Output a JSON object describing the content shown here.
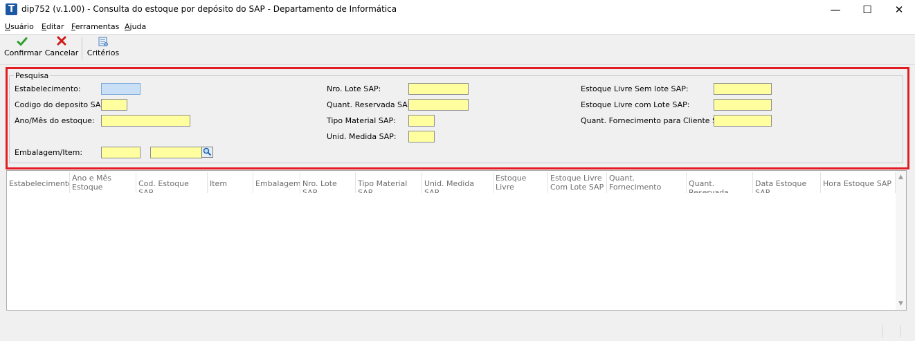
{
  "window": {
    "title": "dip752 (v.1.00) - Consulta do estoque por depósito do SAP - Departamento de Informática",
    "app_icon_letter": "T",
    "minimize_glyph": "—",
    "maximize_glyph": "☐",
    "close_glyph": "✕"
  },
  "menu": [
    {
      "label": "Usuário",
      "accel": "U",
      "rest": "suário"
    },
    {
      "label": "Editar",
      "accel": "E",
      "rest": "ditar"
    },
    {
      "label": "Ferramentas",
      "accel": "F",
      "rest": "erramentas"
    },
    {
      "label": "Ajuda",
      "accel": "A",
      "rest": "juda"
    }
  ],
  "toolbar": {
    "confirm_label": "Confirmar",
    "cancel_label": "Cancelar",
    "criteria_label": "Critérios",
    "confirm_icon": "checkmark-icon",
    "cancel_icon": "x-icon",
    "criteria_icon": "criteria-icon"
  },
  "search": {
    "legend": "Pesquisa",
    "labels": {
      "estabelecimento": "Estabelecimento:",
      "codigo_deposito": "Codigo do deposito SAP:",
      "ano_mes": "Ano/Mês do estoque:",
      "embalagem_item": "Embalagem/Item:",
      "nro_lote": "Nro. Lote SAP:",
      "quant_reservada": "Quant. Reservada SAP:",
      "tipo_material": "Tipo Material SAP:",
      "unid_medida": "Unid. Medida SAP:",
      "estoque_sem_lote": "Estoque Livre Sem lote SAP:",
      "estoque_com_lote": "Estoque Livre com Lote SAP:",
      "quant_fornecimento": "Quant. Fornecimento para Cliente SAP:"
    },
    "values": {
      "estabelecimento": "",
      "codigo_deposito": "",
      "ano_mes": "",
      "embalagem": "",
      "item": "",
      "nro_lote": "",
      "quant_reservada": "",
      "tipo_material": "",
      "unid_medida": "",
      "estoque_sem_lote": "",
      "estoque_com_lote": "",
      "quant_fornecimento": ""
    }
  },
  "grid": {
    "columns": [
      "Estabelecimento",
      "Ano e Mês\nEstoque",
      "Cod. Estoque SAP",
      "Item",
      "Embalagem",
      "Nro. Lote SAP",
      "Tipo Material SAP",
      "Unid. Medida SAP",
      "Estoque Livre\nSem Lote SAP",
      "Estoque Livre\nCom Lote SAP",
      "Quant. Fornecimento\npara Cliente SAP",
      "Quant. Reservada",
      "Data Estoque SAP",
      "Hora Estoque SAP"
    ],
    "rows": []
  },
  "colors": {
    "highlight": "#e31c23",
    "field": "#ffffa0",
    "field_focus": "#c9dff5",
    "confirm": "#2e9e2e",
    "cancel": "#d01818"
  }
}
